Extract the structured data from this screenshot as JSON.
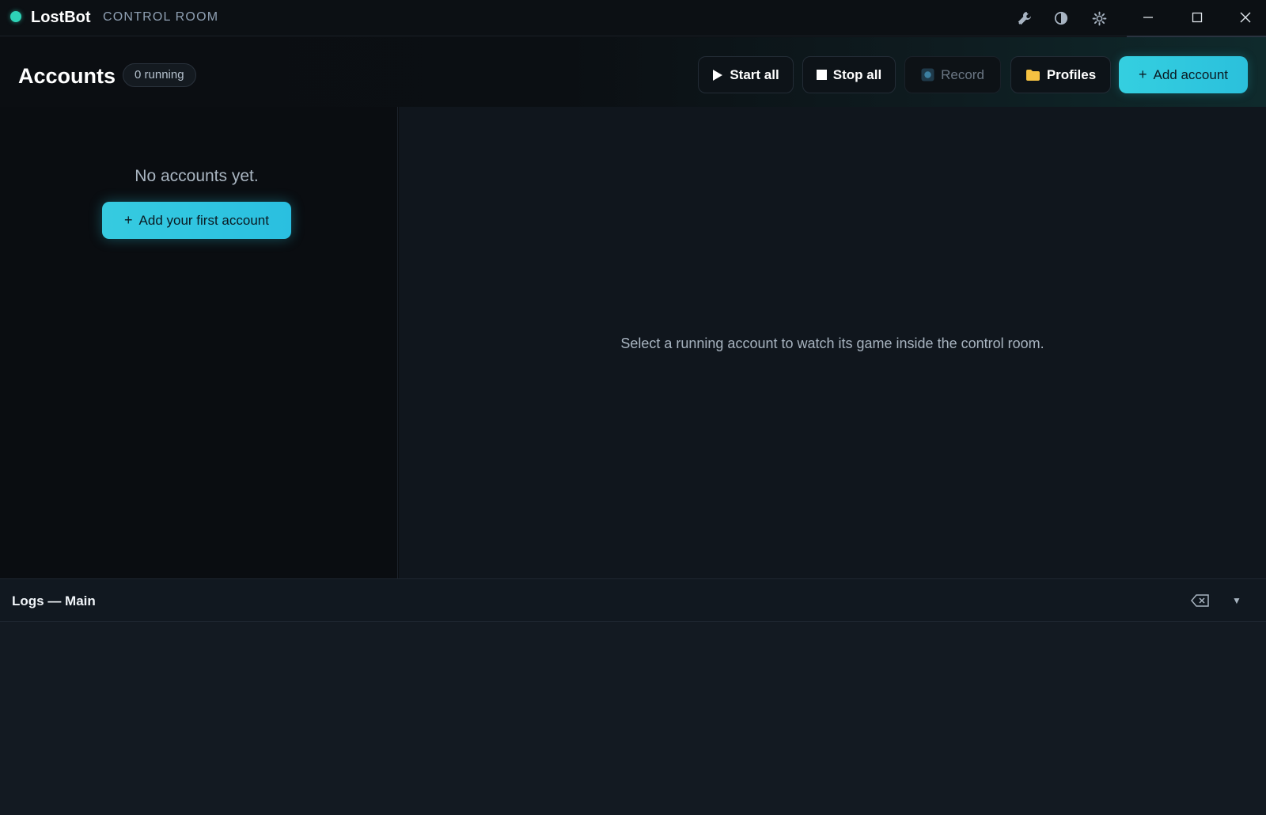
{
  "app": {
    "name": "LostBot",
    "subtitle": "CONTROL ROOM",
    "status_color": "#2ed3b7"
  },
  "titlebar": {
    "icons": [
      "wrench-icon",
      "contrast-icon",
      "gear-icon"
    ],
    "window_controls": [
      "minimize-icon",
      "maximize-icon",
      "close-icon"
    ]
  },
  "header": {
    "title": "Accounts",
    "running_badge": "0 running",
    "buttons": {
      "start_all": "Start all",
      "stop_all": "Stop all",
      "record": "Record",
      "profiles": "Profiles",
      "add_account": "Add account"
    }
  },
  "accounts_panel": {
    "empty_text": "No accounts yet.",
    "add_first_label": "Add your first account"
  },
  "viewer": {
    "message": "Select a running account to watch its game inside the control room."
  },
  "logs": {
    "title": "Logs — Main"
  },
  "colors": {
    "accent": "#2ec6de",
    "background": "#0b0e12",
    "panel": "#10161d"
  }
}
